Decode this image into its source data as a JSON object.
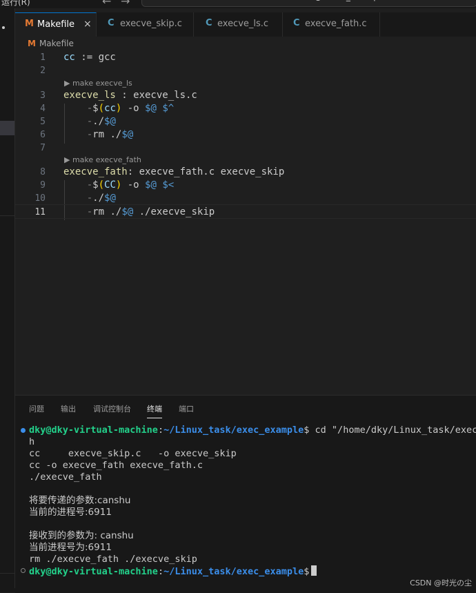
{
  "titlebar": {
    "menu": "运行(R)",
    "more": "···",
    "back_arrow": "←",
    "forward_arrow": "→",
    "search_text": "exec_example"
  },
  "tabs": [
    {
      "icon": "M",
      "label": "Makefile",
      "close": "×",
      "icon_color": "#e37933"
    },
    {
      "icon": "C",
      "label": "execve_skip.c",
      "icon_color": "#519aba"
    },
    {
      "icon": "C",
      "label": "execve_ls.c",
      "icon_color": "#519aba"
    },
    {
      "icon": "C",
      "label": "execve_fath.c",
      "icon_color": "#519aba"
    }
  ],
  "breadcrumb": {
    "icon": "M",
    "label": "Makefile"
  },
  "editor": {
    "lines": [
      {
        "n": "1",
        "text": "cc := gcc"
      },
      {
        "n": "2",
        "text": ""
      },
      {
        "lens": "▶ make execve_ls"
      },
      {
        "n": "3",
        "text": "execve_ls : execve_ls.c"
      },
      {
        "n": "4",
        "text": "    -$(cc) -o $@ $^"
      },
      {
        "n": "5",
        "text": "    -./$@"
      },
      {
        "n": "6",
        "text": "    -rm ./$@"
      },
      {
        "n": "7",
        "text": ""
      },
      {
        "lens": "▶ make execve_fath"
      },
      {
        "n": "8",
        "text": "execve_fath: execve_fath.c execve_skip"
      },
      {
        "n": "9",
        "text": "    -$(CC) -o $@ $<"
      },
      {
        "n": "10",
        "text": "    -./$@"
      },
      {
        "n": "11",
        "text": "    -rm ./$@ ./execve_skip"
      }
    ]
  },
  "panel": {
    "tabs": [
      "问题",
      "输出",
      "调试控制台",
      "终端",
      "端口"
    ],
    "active_tab": "终端"
  },
  "terminal": {
    "user": "dky@dky-virtual-machine",
    "colon": ":",
    "path": "~/Linux_task/exec_example",
    "dollar": "$",
    "command": " cd \"/home/dky/Linux_task/exec_",
    "wrap": "h",
    "out1": "cc     execve_skip.c   -o execve_skip",
    "out2": "cc -o execve_fath execve_fath.c",
    "out3": "./execve_fath",
    "out4": "将要传递的参数:canshu",
    "out5": "当前的进程号:6911",
    "out6": "接收到的参数为: canshu",
    "out7": "当前进程号为:6911",
    "out8": "rm ./execve_fath ./execve_skip"
  },
  "watermark": "CSDN @时光の尘"
}
